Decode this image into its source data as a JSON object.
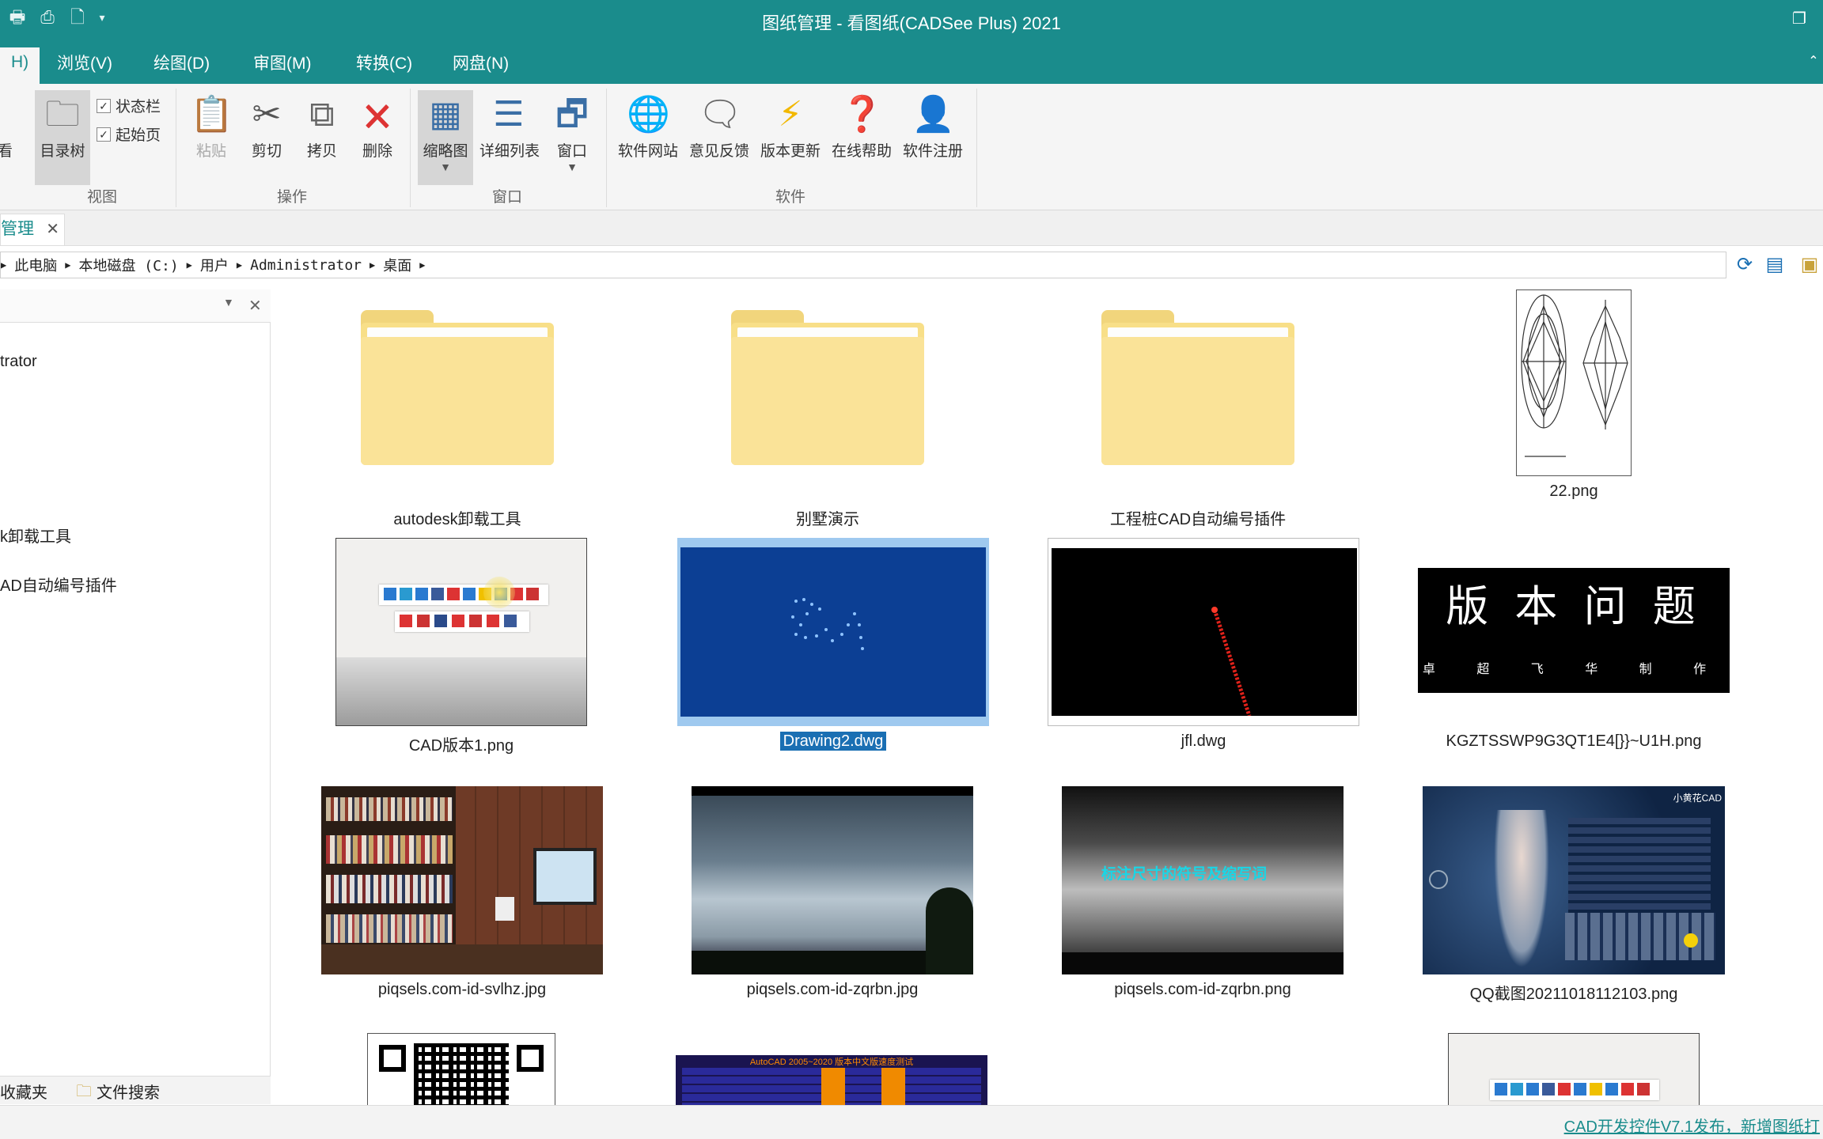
{
  "window": {
    "title": "图纸管理 - 看图纸(CADSee Plus) 2021"
  },
  "menu": [
    {
      "label": "H)",
      "active": true
    },
    {
      "label": "浏览(V)"
    },
    {
      "label": "绘图(D)"
    },
    {
      "label": "审图(M)"
    },
    {
      "label": "转换(C)"
    },
    {
      "label": "网盘(N)"
    }
  ],
  "ribbon": {
    "look_label": "看",
    "view": {
      "tree": "目录树",
      "statusbar": "状态栏",
      "startpage": "起始页",
      "group": "视图"
    },
    "ops": {
      "paste": "粘贴",
      "cut": "剪切",
      "copy": "拷贝",
      "delete": "删除",
      "group": "操作"
    },
    "window": {
      "thumbs": "缩略图",
      "details": "详细列表",
      "window": "窗口",
      "group": "窗口"
    },
    "software": {
      "website": "软件网站",
      "feedback": "意见反馈",
      "update": "版本更新",
      "help": "在线帮助",
      "register": "软件注册",
      "group": "软件"
    }
  },
  "doc_tab": {
    "label": "管理"
  },
  "breadcrumb": [
    "此电脑",
    "本地磁盘 (C:)",
    "用户",
    "Administrator",
    "桌面"
  ],
  "tree": {
    "items": [
      "trator",
      "k卸载工具",
      "AD自动编号插件"
    ]
  },
  "left_tabs": {
    "favorites": "收藏夹",
    "search": "文件搜索"
  },
  "files": [
    {
      "name": "autodesk卸载工具",
      "kind": "folder"
    },
    {
      "name": "别墅演示",
      "kind": "folder"
    },
    {
      "name": "工程桩CAD自动编号插件",
      "kind": "folder"
    },
    {
      "name": "22.png",
      "kind": "drawing"
    },
    {
      "name": "CAD版本1.png",
      "kind": "screenshot"
    },
    {
      "name": "Drawing2.dwg",
      "kind": "dwg-blue",
      "selected": true
    },
    {
      "name": "jfl.dwg",
      "kind": "dwg-black"
    },
    {
      "name": "KGZTSSWP9G3QT1E4[}}~U1H.png",
      "kind": "banner"
    },
    {
      "name": "piqsels.com-id-svlhz.jpg",
      "kind": "bookshelf"
    },
    {
      "name": "piqsels.com-id-zqrbn.jpg",
      "kind": "sky"
    },
    {
      "name": "piqsels.com-id-zqrbn.png",
      "kind": "sky-text"
    },
    {
      "name": "QQ截图20211018112103.png",
      "kind": "qq"
    }
  ],
  "thumb_text": {
    "banner_title": "版 本 问 题",
    "banner_sub": "卓 超 飞 华 制 作",
    "sky_overlay": "标注尺寸的符号及缩写词",
    "qq_corner": "小黄花CAD",
    "autocad_banner": "AutoCAD 2005~2020 版本中文版速度测试"
  },
  "status": {
    "message": "CAD开发控件V7.1发布，新增图纸打"
  }
}
